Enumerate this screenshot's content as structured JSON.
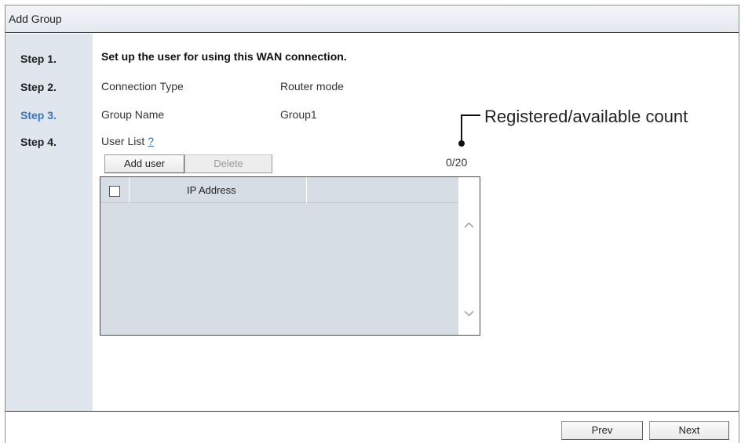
{
  "window": {
    "title": "Add Group"
  },
  "steps": [
    {
      "label": "Step 1.",
      "active": false
    },
    {
      "label": "Step 2.",
      "active": false
    },
    {
      "label": "Step 3.",
      "active": true
    },
    {
      "label": "Step 4.",
      "active": false
    }
  ],
  "form": {
    "heading": "Set up the user for using this WAN connection.",
    "connection_type_label": "Connection Type",
    "connection_type_value": "Router mode",
    "group_name_label": "Group Name",
    "group_name_value": "Group1",
    "user_list_label": "User List",
    "help_link": "?"
  },
  "user_list": {
    "add_user_label": "Add user",
    "delete_label": "Delete",
    "count": "0/20",
    "columns": [
      "IP Address"
    ],
    "rows": []
  },
  "footer": {
    "prev_label": "Prev",
    "next_label": "Next"
  },
  "annotation": {
    "text": "Registered/available count"
  },
  "colors": {
    "active_step": "#3a73c1",
    "step_panel": "#dfe6ee",
    "table_bg": "#d6dde5"
  },
  "icons": {
    "scroll_up": "chevron-up-icon",
    "scroll_down": "chevron-down-icon",
    "select_all": "checkbox-icon"
  }
}
